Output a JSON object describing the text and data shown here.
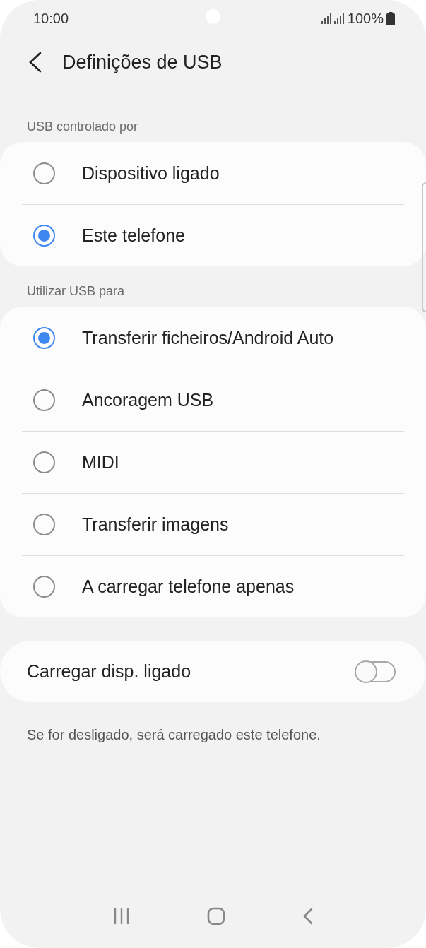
{
  "status_bar": {
    "time": "10:00",
    "battery": "100%"
  },
  "header": {
    "title": "Definições de USB"
  },
  "sections": [
    {
      "label": "USB controlado por",
      "options": [
        {
          "label": "Dispositivo ligado",
          "selected": false
        },
        {
          "label": "Este telefone",
          "selected": true
        }
      ]
    },
    {
      "label": "Utilizar USB para",
      "options": [
        {
          "label": "Transferir ficheiros/Android Auto",
          "selected": true
        },
        {
          "label": "Ancoragem USB",
          "selected": false
        },
        {
          "label": "MIDI",
          "selected": false
        },
        {
          "label": "Transferir imagens",
          "selected": false
        },
        {
          "label": "A carregar telefone apenas",
          "selected": false
        }
      ]
    }
  ],
  "toggle": {
    "label": "Carregar disp. ligado",
    "on": false
  },
  "note": "Se for desligado, será carregado este telefone."
}
